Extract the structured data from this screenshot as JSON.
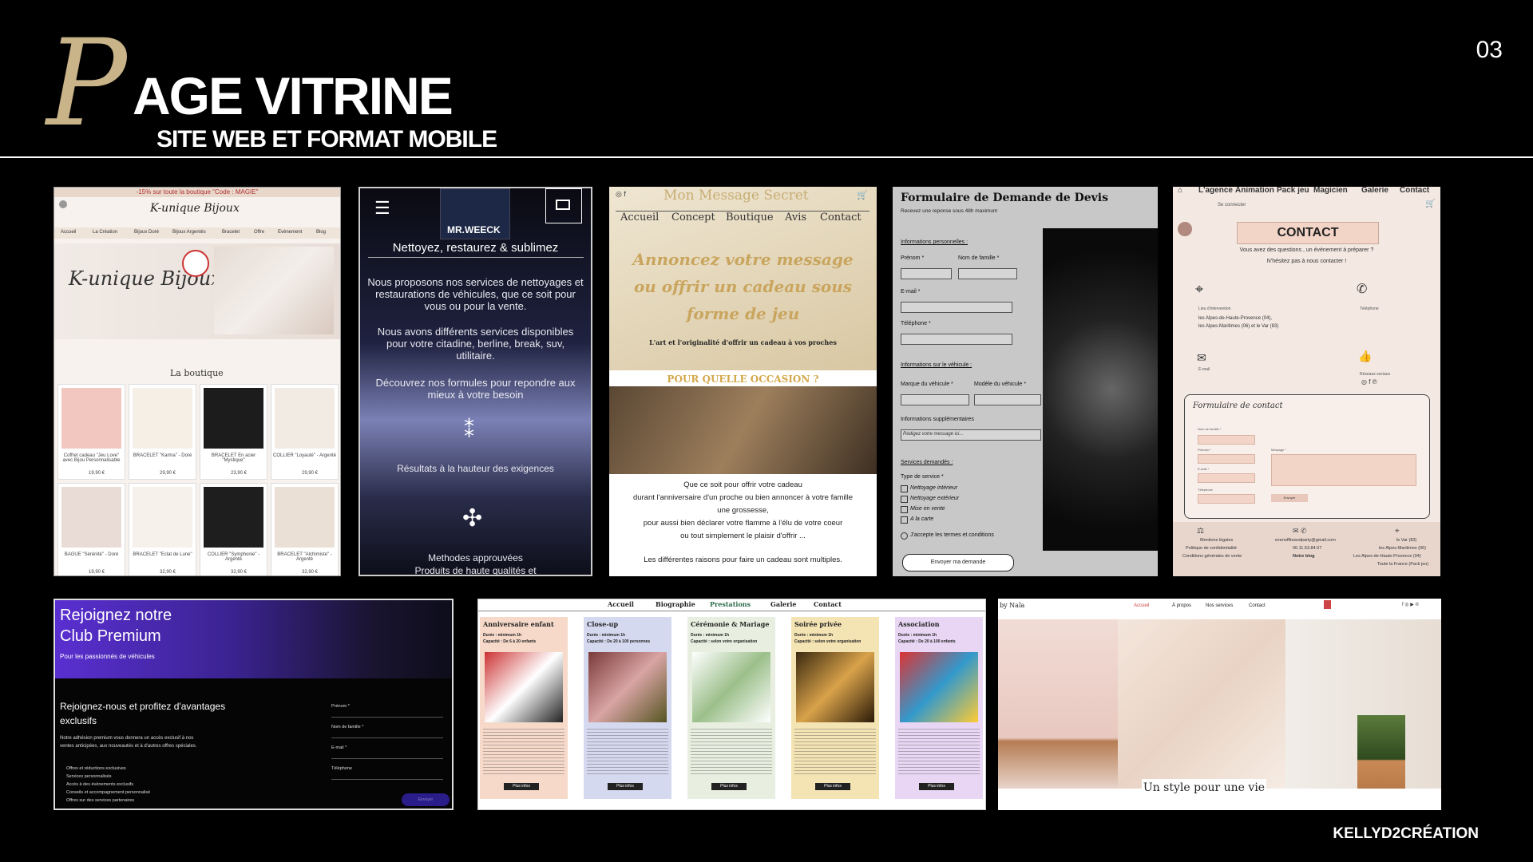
{
  "header": {
    "title_initial": "P",
    "title_rest": "AGE VITRINE",
    "subtitle": "SITE WEB ET FORMAT MOBILE",
    "page_number": "03"
  },
  "footer": {
    "brand": "KELLYD2CRÉATION"
  },
  "shots": {
    "bijoux": {
      "promo": "-15% sur toute la boutique \"Code : MAGIE\"",
      "nav": [
        "Accueil",
        "La Création",
        "Bijoux Doré",
        "Bijoux Argentés",
        "Bracelet",
        "Offre",
        "Evènement",
        "Blog"
      ],
      "brand": "K-unique Bijoux",
      "section": "La boutique",
      "products": [
        {
          "name": "Coffret cadeau \"Jeu Love\" avec Bijou Personnalisable",
          "price": "19,90 €"
        },
        {
          "name": "BRACELET \"Karma\" - Doré",
          "price": "29,90 €"
        },
        {
          "name": "BRACELET En acier \"Mystique\"",
          "price": "23,90 €"
        },
        {
          "name": "COLLIER \"Loyauté\" - Argenté",
          "price": "29,90 €"
        },
        {
          "name": "BAGUE \"Sérénité\" - Doré",
          "price": "19,90 €"
        },
        {
          "name": "BRACELET \"Eclat de Lune\"",
          "price": "32,90 €"
        },
        {
          "name": "COLLIER \"Symphonie\" - Argenté",
          "price": "32,90 €"
        },
        {
          "name": "BRACELET \"Alchimiste\" - Argenté",
          "price": "32,90 €"
        }
      ]
    },
    "mrweeck": {
      "logo": "MR.WEECK",
      "headline": "Nettoyez, restaurez & sublimez",
      "p1": "Nous proposons nos services de nettoyages et restaurations de véhicules, que ce soit pour vous ou pour la vente.",
      "p2": "Nous avons différents services disponibles pour votre citadine, berline, break, suv, utilitaire.",
      "p3": "Découvrez nos formules pour repondre aux mieux à votre besoin",
      "p4": "Résultats à la hauteur des exigences",
      "p5": "Methodes approuvées",
      "p6": "Produits de haute qualités et"
    },
    "message": {
      "brand": "Mon Message Secret",
      "nav": [
        "Accueil",
        "Concept",
        "Boutique",
        "Avis",
        "Contact"
      ],
      "hero": "Annoncez votre message ou offrir un cadeau sous forme de jeu",
      "tagline": "L'art et l'originalité d'offrir un cadeau à vos proches",
      "occasion": "POUR QUELLE OCCASION ?",
      "p1": "Que ce soit pour offrir votre cadeau",
      "p2": "durant l'anniversaire d'un proche ou bien annoncer à votre famille",
      "p3": "une grossesse,",
      "p4": "pour aussi bien déclarer votre flamme à l'élu de votre coeur",
      "p5": "ou tout simplement le plaisir d'offrir ...",
      "p6": "Les différentes raisons pour faire un cadeau sont multiples."
    },
    "devis": {
      "title": "Formulaire de Demande de Devis",
      "note": "Recevez une reponse sous 48h maximum",
      "sec_personal": "Informations personnelles :",
      "prenom": "Prénom *",
      "nom": "Nom de famille *",
      "email": "E-mail *",
      "tel": "Téléphone *",
      "sec_vehicle": "Informations sur le véhicule :",
      "marque": "Marque du véhicule *",
      "modele": "Modèle du véhicule *",
      "sec_extra": "Informations supplémentaires",
      "placeholder": "Rédigez votre message ici...",
      "sec_services": "Services demandés :",
      "type": "Type de service *",
      "services": [
        "Nettoyage intérieur",
        "Nettoyage extérieur",
        "Mise en vente",
        "A la carte"
      ],
      "terms": "J'accepte les termes et conditions",
      "submit": "Envoyer ma demande"
    },
    "contact": {
      "nav": [
        "L'agence",
        "Animation",
        "Pack jeu",
        "Magicien",
        "Galerie",
        "Contact"
      ],
      "login": "Se connecter",
      "title": "CONTACT",
      "intro1": "Vous avez des questions , un événement à préparer ?",
      "intro2": "N'hésitez pas à nous contacter !",
      "loc_label": "Lieu d'intervention",
      "loc1": "les Alpes-de-Haute-Provence (04),",
      "loc2": "les Alpes-Maritimes (06) et le Var (83)",
      "phone_label": "Téléphone",
      "email_label": "E-mail",
      "reviews": "Réseaux sociaux",
      "form_title": "Formulaire de contact",
      "f_nom": "Nom de famille *",
      "f_prenom": "Prénom *",
      "f_email": "E-mail *",
      "f_tel": "Téléphone",
      "f_msg": "Message *",
      "f_send": "Envoyer",
      "foot1": "Mentions légales",
      "foot2": "Politique de confidentialité",
      "foot3": "Conditions générales de vente",
      "foot4": "evenoffiteandparty@gmail.com",
      "foot5": "06.11.53.84.07",
      "foot6": "Notre blog",
      "foot7": "le Var (83)",
      "foot8": "les Alpes-Maritimes (06)",
      "foot9": "Les Alpes-de-Haute-Provence (04)",
      "foot10": "Toute la France (Pack jeu)"
    },
    "premium": {
      "title1": "Rejoignez notre",
      "title2": "Club Premium",
      "sub": "Pour les passionnés de véhicules",
      "lead1": "Rejoignez-nous et profitez d'avantages",
      "lead2": "exclusifs",
      "p1": "Notre adhésion premium vous donnera un accès exclusif à nos",
      "p2": "ventes anticipées, aux nouveautés et à d'autres offres spéciales.",
      "bullets": [
        "Offres et réductions exclusives",
        "Services personnalisés",
        "Accès à des événements exclusifs",
        "Conseils et accompagnement personnalisé",
        "Offres sur des services partenaires"
      ],
      "f1": "Prénom *",
      "f2": "Nom de famille *",
      "f3": "E-mail *",
      "f4": "Téléphone",
      "btn": "Envoyer"
    },
    "prestations": {
      "nav": [
        "Accueil",
        "Biographie",
        "Prestations",
        "Galerie",
        "Contact"
      ],
      "cols": [
        {
          "title": "Anniversaire enfant",
          "d1": "Durée : minimum 1h",
          "d2": "Capacité : De 6 à 20 enfants",
          "bg": "#f6d9c9"
        },
        {
          "title": "Close-up",
          "d1": "Durée : minimum 1h",
          "d2": "Capacité : De 20 à 100 personnes",
          "bg": "#d4d9ef"
        },
        {
          "title": "Cérémonie & Mariage",
          "d1": "Durée : minimum 1h",
          "d2": "Capacité : selon votre organisation",
          "bg": "#e9efe0"
        },
        {
          "title": "Soirée privée",
          "d1": "Durée : minimum 1h",
          "d2": "Capacité : selon votre organisation",
          "bg": "#f4e3b3"
        },
        {
          "title": "Association",
          "d1": "Durée : minimum 1h",
          "d2": "Capacité : De 20 à 100 enfants",
          "bg": "#e8d6f4"
        }
      ],
      "btn": "Plus infos"
    },
    "nala": {
      "brand": "by Nala",
      "nav": [
        "Accueil",
        "À propos",
        "Nos services",
        "Contact"
      ],
      "slogan": "Un style pour une vie"
    }
  }
}
